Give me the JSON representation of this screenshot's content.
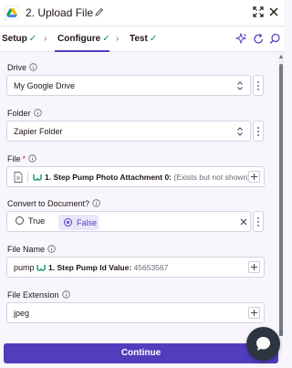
{
  "header": {
    "title": "2. Upload File",
    "app_icon": "google-drive-icon",
    "edit_icon": "pencil-icon",
    "expand_icon": "expand-icon",
    "close_icon": "close-icon"
  },
  "tabs": [
    {
      "label": "Setup",
      "status": "✓"
    },
    {
      "label": "Configure",
      "status": "✓"
    },
    {
      "label": "Test",
      "status": "✓"
    }
  ],
  "fields": {
    "drive": {
      "label": "Drive",
      "value": "My Google Drive"
    },
    "folder": {
      "label": "Folder",
      "value": "Zapier Folder"
    },
    "file": {
      "label": "File",
      "required_mark": "*",
      "step_label": "1. Step Pump Photo Attachment 0:",
      "hint": "(Exists but not shown)"
    },
    "convert": {
      "label": "Convert to Document?",
      "options": [
        "True",
        "False"
      ],
      "selected": "False"
    },
    "file_name": {
      "label": "File Name",
      "prefix": "pump",
      "step_label": "1. Step Pump Id Value:",
      "step_value": "45653567"
    },
    "file_extension": {
      "label": "File Extension",
      "value": "jpeg"
    }
  },
  "footer": {
    "continue_label": "Continue"
  },
  "colors": {
    "accent": "#503ebd",
    "success": "#1e8a4c",
    "pill_icon": "#1d9c6f"
  }
}
